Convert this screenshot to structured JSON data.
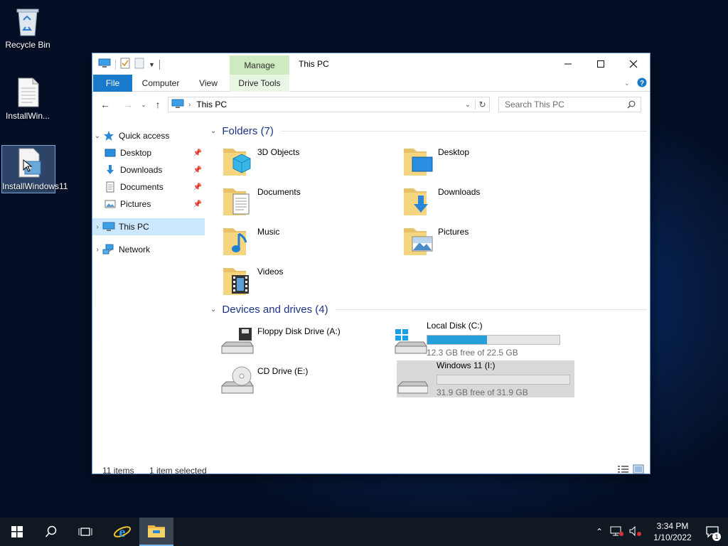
{
  "desktop": {
    "icons": [
      {
        "label": "Recycle Bin"
      },
      {
        "label": "InstallWin..."
      },
      {
        "label": "InstallWindows11"
      }
    ]
  },
  "window": {
    "title": "This PC",
    "context_tab": "Manage",
    "ribbon_tabs": [
      "File",
      "Computer",
      "View",
      "Drive Tools"
    ],
    "address": "This PC",
    "search_placeholder": "Search This PC",
    "nav": {
      "quick_access": "Quick access",
      "items": [
        "Desktop",
        "Downloads",
        "Documents",
        "Pictures"
      ],
      "this_pc": "This PC",
      "network": "Network"
    },
    "folders_header": "Folders (7)",
    "folders": [
      "3D Objects",
      "Desktop",
      "Documents",
      "Downloads",
      "Music",
      "Pictures",
      "Videos"
    ],
    "devices_header": "Devices and drives (4)",
    "devices": [
      {
        "name": "Floppy Disk Drive (A:)"
      },
      {
        "name": "Local Disk (C:)",
        "free": "12.3 GB free of 22.5 GB",
        "used_fraction": 0.45
      },
      {
        "name": "CD Drive (E:)"
      },
      {
        "name": "Windows 11 (I:)",
        "free": "31.9 GB free of 31.9 GB",
        "used_fraction": 0.0
      }
    ],
    "status": {
      "items": "11 items",
      "selected": "1 item selected"
    }
  },
  "taskbar": {
    "time": "3:34 PM",
    "date": "1/10/2022",
    "notification_count": "1"
  },
  "colors": {
    "accent": "#1979ca",
    "selection": "#cce8ff",
    "drive_bar": "#26a0da"
  }
}
